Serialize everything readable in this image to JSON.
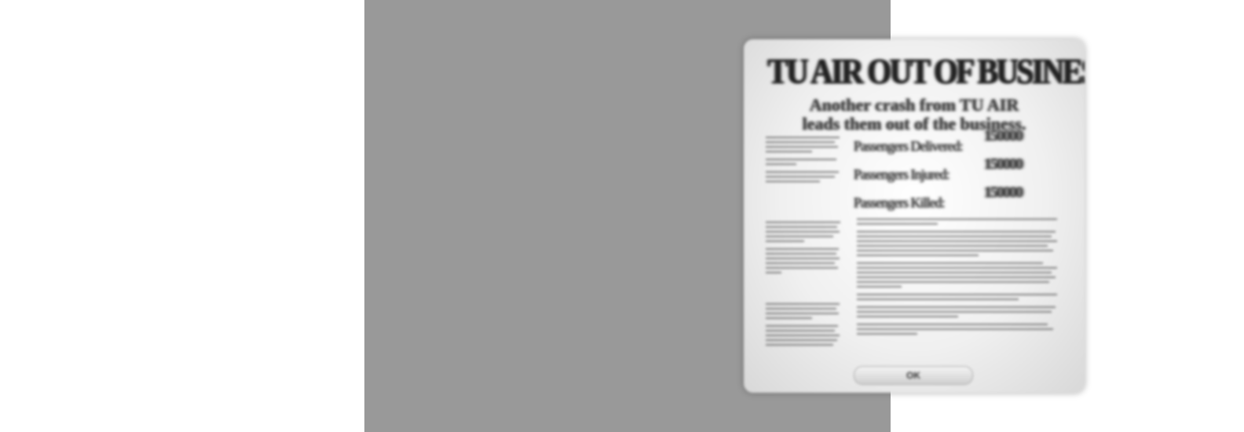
{
  "newspaper": {
    "headline": "TU AIR OUT OF BUSINESS",
    "subheadline_line1": "Another crash from TU AIR",
    "subheadline_line2": "leads them out of the business.",
    "stats": [
      {
        "label": "Passengers Delivered:",
        "value": "150000"
      },
      {
        "label": "Passengers Injured:",
        "value": "150000"
      },
      {
        "label": "Passengers Killed:",
        "value": "150000"
      }
    ],
    "ok_button_label": "OK"
  },
  "colors": {
    "background": "#ffffff",
    "panel": "#999999",
    "paper": "#f0f0f0"
  }
}
